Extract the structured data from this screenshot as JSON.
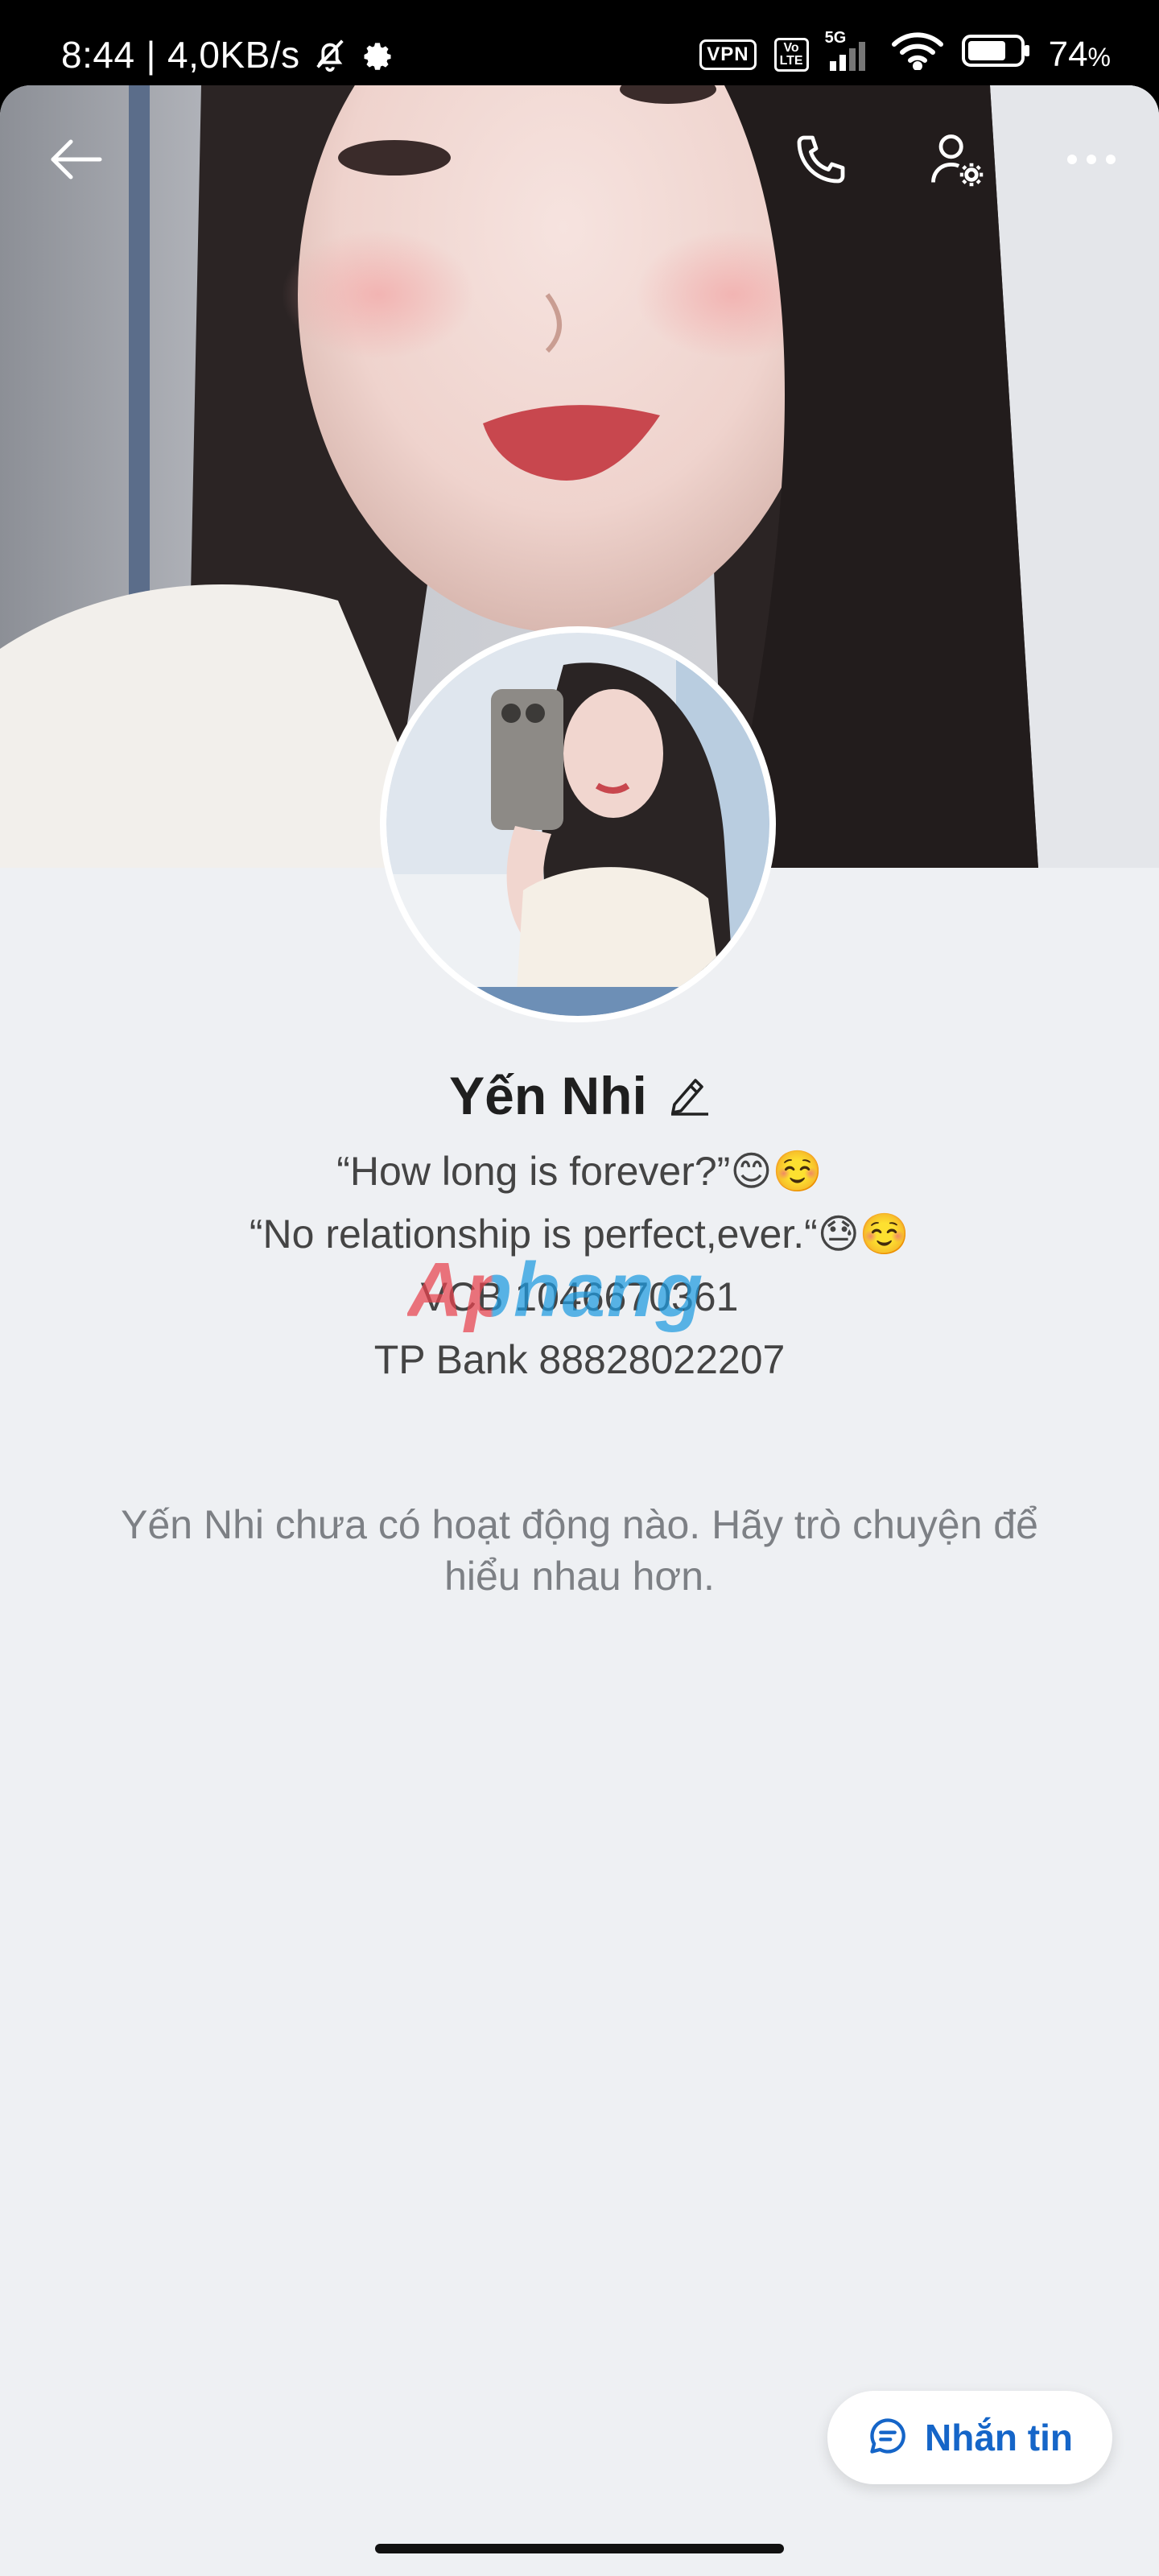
{
  "status_bar": {
    "time": "8:44",
    "network_speed": "4,0KB/s",
    "vpn_label": "VPN",
    "volte_label": "Vo\nLTE",
    "network_type": "5G",
    "battery_percent": "74",
    "battery_unit": "%",
    "icons": [
      "bell-off-icon",
      "gear-icon",
      "signal-icon",
      "wifi-icon",
      "battery-icon"
    ]
  },
  "top_bar": {
    "icons": [
      "back-arrow-icon",
      "phone-icon",
      "user-settings-icon",
      "more-icon"
    ]
  },
  "profile": {
    "name": "Yến Nhi",
    "bio_lines": [
      "“How long is forever?”😊☺️",
      "“No relationship is perfect,ever.“😓☺️",
      "VCB 1046670361",
      "TP Bank 88828022207"
    ]
  },
  "watermark": "Aphang",
  "empty_state": "Yến Nhi chưa có hoạt động nào. Hãy trò chuyện để hiểu nhau hơn.",
  "message_button": {
    "label": "Nhắn tin"
  },
  "colors": {
    "accent": "#1565c8",
    "background": "#eef0f3"
  }
}
